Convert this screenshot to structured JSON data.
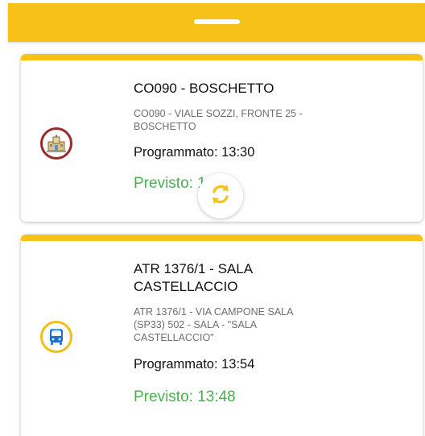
{
  "header": {
    "handle": "drag-handle"
  },
  "colors": {
    "accent": "#f6c21a",
    "expected_text": "#4caf50",
    "stop_icon_ring_1": "#9b2a2a",
    "stop_icon_ring_2": "#f2be1a"
  },
  "stops": [
    {
      "icon": "building-icon",
      "title": "CO090 - BOSCHETTO",
      "address": "CO090 - VIALE SOZZI, FRONTE 25 - BOSCHETTO",
      "scheduled": "Programmato: 13:30",
      "expected": "Previsto: 13:30"
    },
    {
      "icon": "bus-icon",
      "title": "ATR 1376/1 - SALA CASTELLACCIO",
      "address": "ATR 1376/1 - VIA CAMPONE SALA (SP33) 502 - SALA - \"SALA CASTELLACCIO\"",
      "scheduled": "Programmato: 13:54",
      "expected": "Previsto: 13:48"
    }
  ],
  "refresh": {
    "icon": "refresh-icon"
  }
}
